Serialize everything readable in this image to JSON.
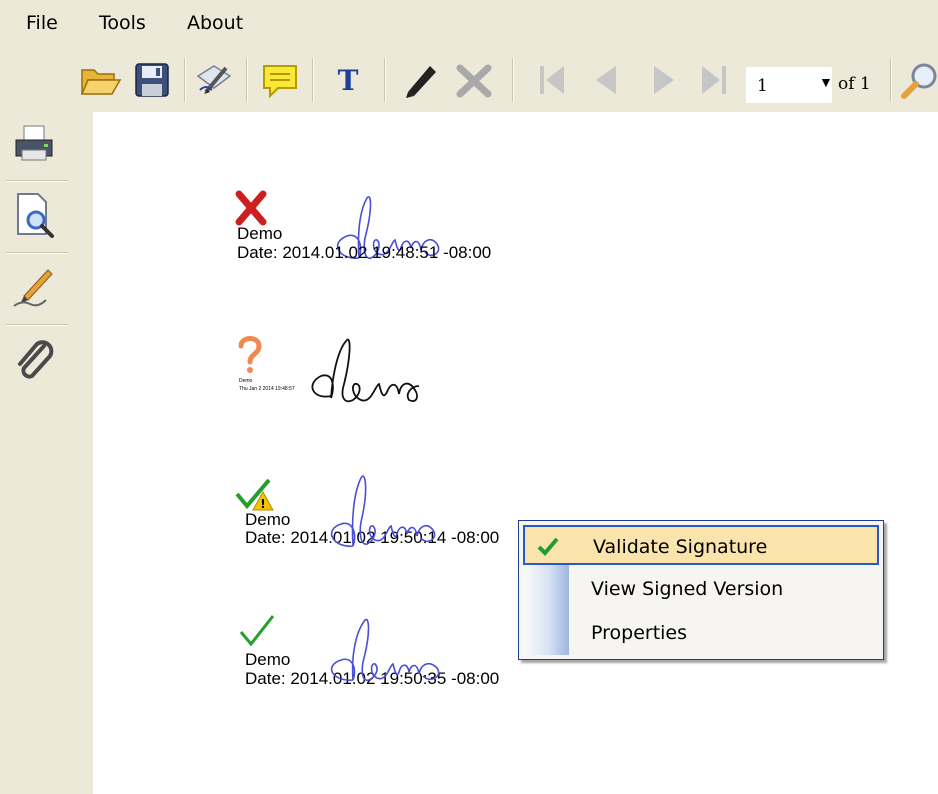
{
  "menubar": {
    "items": [
      "File",
      "Tools",
      "About"
    ]
  },
  "toolbar": {
    "buttons": [
      "open-icon",
      "save-icon",
      "sign-icon",
      "comment-icon",
      "text-icon",
      "pencil-icon",
      "delete-icon",
      "first-page-icon",
      "prev-page-icon",
      "next-page-icon",
      "last-page-icon",
      "zoom-icon"
    ],
    "page_value": "1",
    "of_label": "of 1"
  },
  "sidebar": {
    "buttons": [
      "print-icon",
      "preview-icon",
      "signature-pen-icon",
      "attachment-icon"
    ]
  },
  "signatures": [
    {
      "status": "invalid",
      "name": "Demo",
      "date": "Date: 2014.01.02 19:48:51 -08:00"
    },
    {
      "status": "unknown",
      "name": "Demo",
      "date": "Thu Jan 2 2014 19:48:57"
    },
    {
      "status": "valid-warning",
      "name": "Demo",
      "date": "Date: 2014.01.02 19:50:14 -08:00"
    },
    {
      "status": "valid",
      "name": "Demo",
      "date": "Date: 2014.01.02 19:50:35 -08:00"
    }
  ],
  "signature_handwriting": "demo",
  "context_menu": {
    "items": [
      {
        "label": "Validate Signature",
        "checked": true
      },
      {
        "label": "View Signed Version",
        "checked": false
      },
      {
        "label": "Properties",
        "checked": false
      }
    ]
  },
  "colors": {
    "chrome": "#ece9d8",
    "ink_blue": "#4a4fd6",
    "highlight": "#fbe3ac",
    "menu_border": "#1c3f8c"
  }
}
